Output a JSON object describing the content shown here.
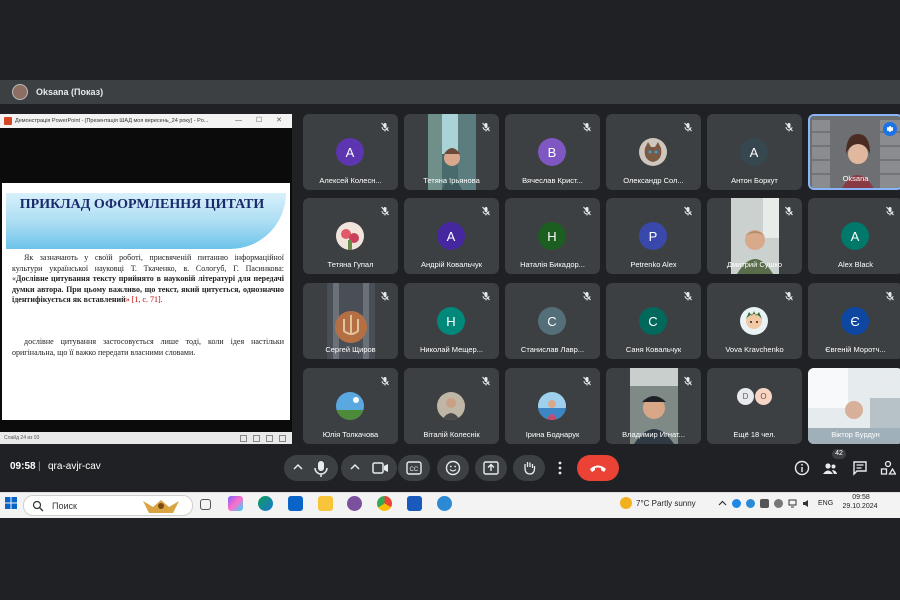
{
  "presenter": {
    "name": "Oksana (Показ)"
  },
  "shared_screen": {
    "window_title": "Демонстрація PowerPoint - [Презентація ШАД моя вересень_24 року] - Po...",
    "window_buttons": "— ☐ ✕",
    "slide_title": "ПРИКЛАД ОФОРМЛЕННЯ ЦИТАТИ",
    "para1_normal": "Як зазначають у своїй роботі, присвяченій питанню інформаційної культури української науковці Т. Ткаченко, в. Сологуб, Г. Пасинкова: «",
    "para1_bold": "Дослівне цитування тексту прийнято в науковій літературі для передачі думки автора. При цьому важливо, що текст, який цитується, однозначно ідентифікується як вставлений",
    "para1_ref": "» [1, с. 71].",
    "para2": "дослівне цитування застосовується лише тоді, коли ідея настільки оригінальна, що її важко передати власними словами.",
    "status": "Слайд 24 из 93"
  },
  "participants": [
    {
      "name": "Алексей Колесн...",
      "initial": "A",
      "color": "#5e35b1",
      "type": "letter"
    },
    {
      "name": "Тетяна Ірьянова",
      "type": "video",
      "video": "waterfall"
    },
    {
      "name": "Вячеслав Крист...",
      "initial": "B",
      "color": "#7e57c2",
      "type": "letter"
    },
    {
      "name": "Олександр Сол...",
      "type": "photo",
      "photo": "cat"
    },
    {
      "name": "Антон Боркут",
      "initial": "A",
      "color": "#37474f",
      "type": "letter"
    },
    {
      "name": "Oksana",
      "type": "video",
      "video": "oksana",
      "speaking": true
    },
    {
      "name": "Тетяна Гупал",
      "type": "photo",
      "photo": "flowers"
    },
    {
      "name": "Андрій Ковальчук",
      "initial": "A",
      "color": "#4527a0",
      "type": "letter"
    },
    {
      "name": "Наталія Бикадор...",
      "initial": "H",
      "color": "#1b5e20",
      "type": "letter"
    },
    {
      "name": "Petrenko Alex",
      "initial": "P",
      "color": "#3949ab",
      "type": "letter"
    },
    {
      "name": "Дмитрий Сушко",
      "type": "video",
      "video": "man1"
    },
    {
      "name": "Alex Black",
      "initial": "A",
      "color": "#00796b",
      "type": "letter"
    },
    {
      "name": "Сергей Щиров",
      "type": "video",
      "video": "emblem"
    },
    {
      "name": "Николай Мещер...",
      "initial": "H",
      "color": "#00897b",
      "type": "letter"
    },
    {
      "name": "Станислав Лавр...",
      "initial": "C",
      "color": "#546e7a",
      "type": "letter"
    },
    {
      "name": "Саня Ковальчук",
      "initial": "C",
      "color": "#00695c",
      "type": "letter"
    },
    {
      "name": "Vova Kravchenko",
      "type": "photo",
      "photo": "cartoon"
    },
    {
      "name": "Євгеній Моротч...",
      "initial": "Є",
      "color": "#0d47a1",
      "type": "letter"
    },
    {
      "name": "Юлія Толкачова",
      "type": "photo",
      "photo": "sky"
    },
    {
      "name": "Віталій Колеснік",
      "type": "photo",
      "photo": "portrait"
    },
    {
      "name": "Ірина Боднарук",
      "type": "photo",
      "photo": "sea"
    },
    {
      "name": "Владимир Игнат...",
      "type": "video",
      "video": "man2"
    },
    {
      "name": "Ещё 18 чел.",
      "type": "more",
      "initials": [
        "D",
        "O"
      ]
    },
    {
      "name": "Віктор Бурдун",
      "type": "video",
      "video": "room"
    }
  ],
  "controls": {
    "time": "09:58",
    "separator": "|",
    "meeting_code": "qra-avjr-cav",
    "people_count": "42"
  },
  "taskbar": {
    "search_placeholder": "Поиск",
    "weather": "7°C  Partly sunny",
    "language": "ENG",
    "time": "09:58",
    "date": "29.10.2024"
  }
}
